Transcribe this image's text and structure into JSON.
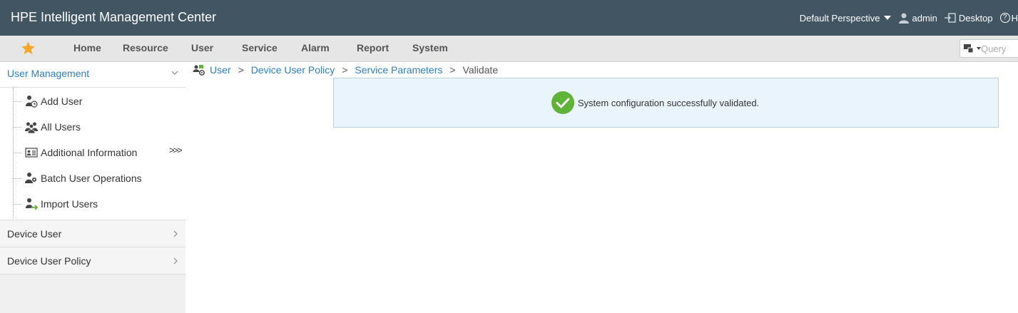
{
  "header": {
    "app_title": "HPE Intelligent Management Center",
    "perspective": "Default Perspective",
    "user": "admin",
    "desktop": "Desktop",
    "help": "H"
  },
  "nav": {
    "items": [
      "Home",
      "Resource",
      "User",
      "Service",
      "Alarm",
      "Report",
      "System"
    ],
    "query_placeholder": "Query"
  },
  "sidebar": {
    "user_management": {
      "title": "User Management",
      "items": [
        {
          "label": "Add User",
          "icon": "add-user-icon"
        },
        {
          "label": "All Users",
          "icon": "all-users-icon"
        },
        {
          "label": "Additional Information",
          "icon": "info-card-icon"
        },
        {
          "label": "Batch User Operations",
          "icon": "batch-users-icon"
        },
        {
          "label": "Import Users",
          "icon": "import-users-icon"
        }
      ],
      "expand": ">>>"
    },
    "sections": [
      "Device User",
      "Device User Policy"
    ]
  },
  "breadcrumb": {
    "items": [
      "User",
      "Device User Policy",
      "Service Parameters"
    ],
    "separator": ">",
    "current": "Validate"
  },
  "message": {
    "text": "System configuration successfully validated.",
    "status_color": "#5fb336"
  },
  "colors": {
    "header_bg": "#425563",
    "link": "#2e80c0",
    "favorite_star": "#f5a623"
  }
}
